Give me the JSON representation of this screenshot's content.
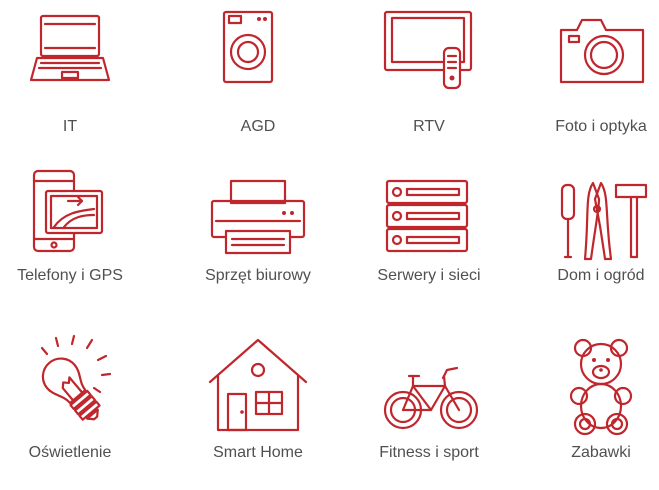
{
  "accent_color": "#c0272d",
  "label_color": "#505050",
  "categories": [
    {
      "label": "IT",
      "icon": "laptop-icon"
    },
    {
      "label": "AGD",
      "icon": "washing-machine-icon"
    },
    {
      "label": "RTV",
      "icon": "tv-remote-icon"
    },
    {
      "label": "Foto i optyka",
      "icon": "camera-icon"
    },
    {
      "label": "Telefony i GPS",
      "icon": "phone-gps-icon"
    },
    {
      "label": "Sprzęt biurowy",
      "icon": "printer-icon"
    },
    {
      "label": "Serwery i sieci",
      "icon": "server-rack-icon"
    },
    {
      "label": "Dom i ogród",
      "icon": "garden-tools-icon"
    },
    {
      "label": "Oświetlenie",
      "icon": "light-bulb-icon"
    },
    {
      "label": "Smart Home",
      "icon": "smart-house-icon"
    },
    {
      "label": "Fitness i sport",
      "icon": "bicycle-icon"
    },
    {
      "label": "Zabawki",
      "icon": "teddy-bear-icon"
    }
  ]
}
